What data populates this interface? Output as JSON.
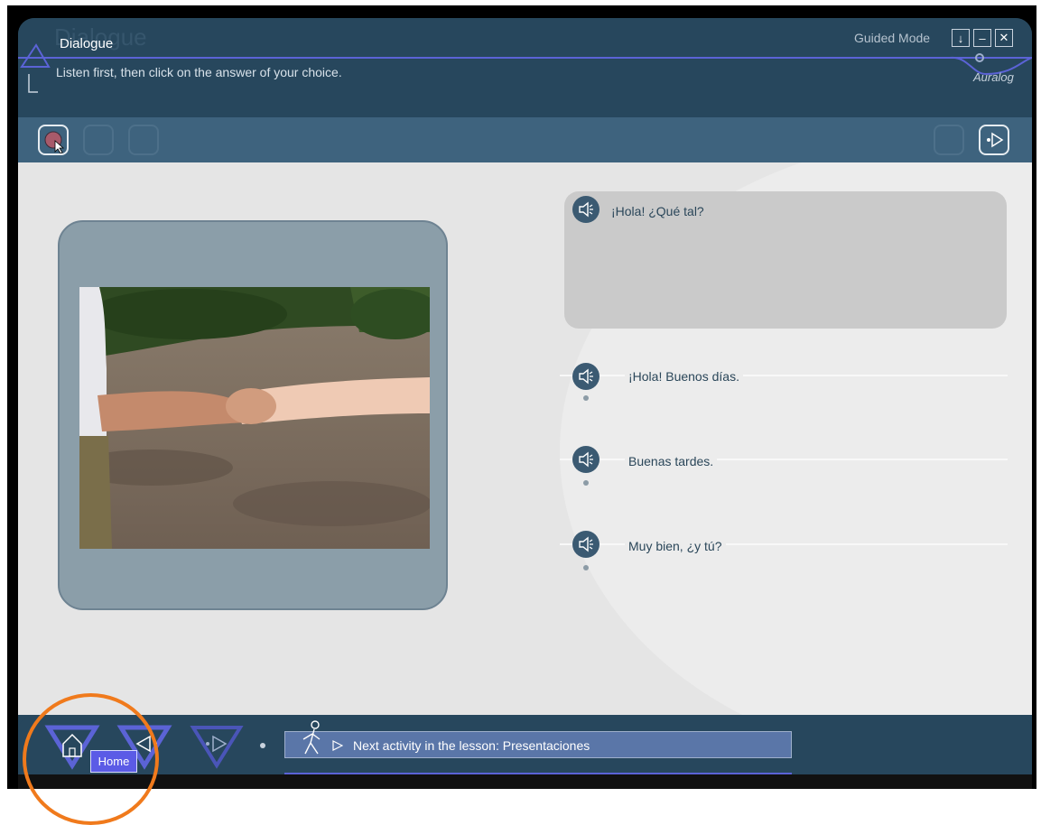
{
  "window": {
    "title": "Dialogue",
    "instructions": "Listen first, then click on the answer of your choice.",
    "mode_label": "Guided Mode",
    "brand": "Auralog"
  },
  "dialogue": {
    "prompt": "¡Hola! ¿Qué tal?",
    "options": [
      {
        "text": "¡Hola! Buenos días."
      },
      {
        "text": "Buenas tardes."
      },
      {
        "text": "Muy bien, ¿y tú?"
      }
    ]
  },
  "navigation": {
    "home_tooltip": "Home",
    "next_activity": "Next activity in the lesson: Presentaciones"
  },
  "colors": {
    "header": "#27475d",
    "toolbar": "#3e637e",
    "accent": "#5b63d6",
    "highlight": "#f07a1c"
  }
}
